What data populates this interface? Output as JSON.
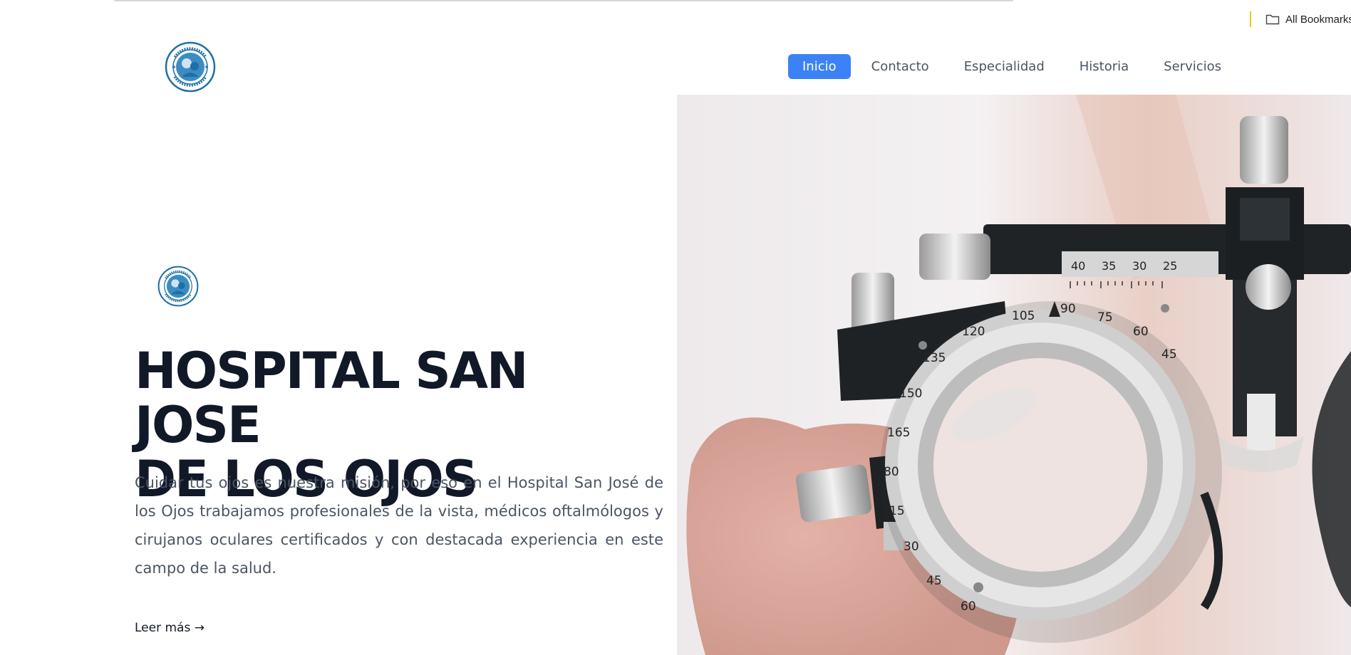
{
  "browser": {
    "bookmarks_label": "All Bookmarks",
    "bookmarks_icon": "folder-icon"
  },
  "header": {
    "logo_alt": "Hospital San Jose logo",
    "nav": [
      {
        "label": "Inicio",
        "active": true
      },
      {
        "label": "Contacto",
        "active": false
      },
      {
        "label": "Especialidad",
        "active": false
      },
      {
        "label": "Historia",
        "active": false
      },
      {
        "label": "Servicios",
        "active": false
      }
    ],
    "active_color": "#3b82f6"
  },
  "hero": {
    "title_line1": "HOSPITAL SAN JOSE",
    "title_line2": "DE LOS OJOS",
    "description": "Cuidar tus ojos es nuestra misión, por eso en el Hospital San José de los Ojos trabajamos profesionales de la vista, médicos oftalmólogos y cirujanos oculares certificados y con destacada experiencia en este campo de la salud.",
    "read_more": "Leer más →",
    "scale_numbers": [
      "40",
      "35",
      "30",
      "25"
    ],
    "dial_numbers": [
      "105",
      "90",
      "75",
      "60",
      "45",
      "120",
      "135",
      "150",
      "165",
      "80",
      "15",
      "30",
      "45",
      "60"
    ]
  },
  "colors": {
    "title": "#111827",
    "body_text": "#4b5563",
    "logo_blue": "#1f6fa6"
  }
}
